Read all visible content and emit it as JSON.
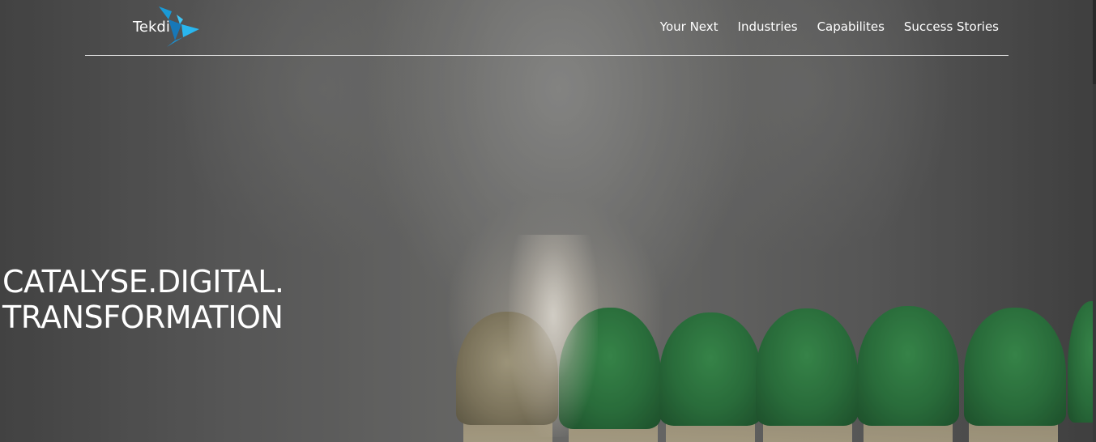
{
  "brand": {
    "name": "Tekdi",
    "logo_icon": "tekdi-arrow-mark-icon",
    "accent_color": "#1a9ad6"
  },
  "nav": {
    "items": [
      {
        "label": "Your Next"
      },
      {
        "label": "Industries"
      },
      {
        "label": "Capabilites"
      },
      {
        "label": "Success Stories"
      }
    ]
  },
  "hero": {
    "headline_line1": "CATALYSE.DIGITAL.",
    "headline_line2": "TRANSFORMATION",
    "background": "matchsticks-lighting-photo",
    "match_color": "#2c7d41"
  }
}
